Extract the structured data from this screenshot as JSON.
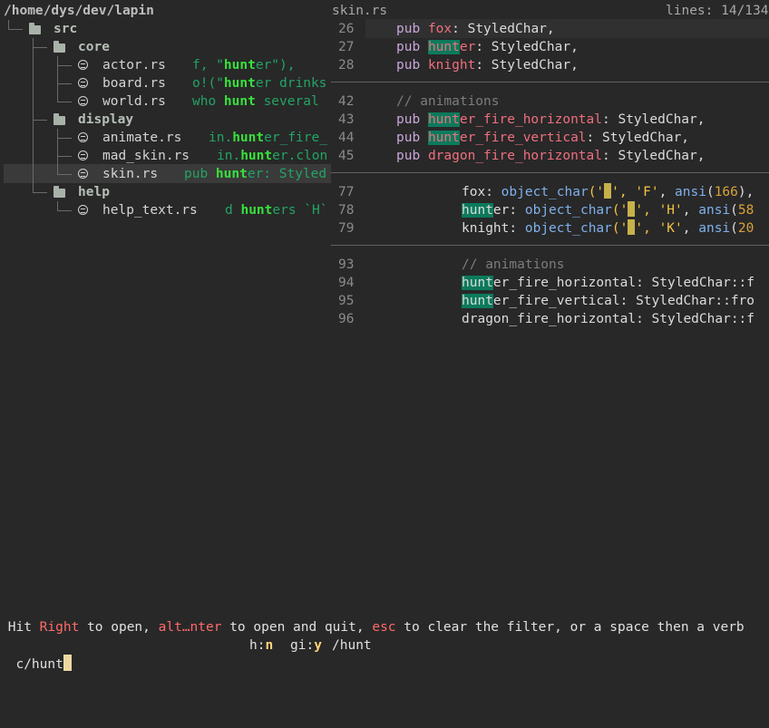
{
  "tree": {
    "root": "/home/dys/dev/lapin",
    "dirs": {
      "src": "src",
      "core": "core",
      "display": "display",
      "help": "help"
    },
    "files": [
      {
        "name": "actor.rs",
        "pre": "f, \"",
        "match": "hunt",
        "post": "er\"),"
      },
      {
        "name": "board.rs",
        "pre": "o!(\"",
        "match": "hunt",
        "post": "er drinks"
      },
      {
        "name": "world.rs",
        "pre": "who ",
        "match": "hunt",
        "post": " several"
      },
      {
        "name": "animate.rs",
        "pre": "in.",
        "match": "hunt",
        "post": "er_fire_"
      },
      {
        "name": "mad_skin.rs",
        "pre": "in.",
        "match": "hunt",
        "post": "er.clon"
      },
      {
        "name": "skin.rs",
        "pre": "pub ",
        "match": "hunt",
        "post": "er: Styled"
      },
      {
        "name": "help_text.rs",
        "pre": "d ",
        "match": "hunt",
        "post": "ers `H`"
      }
    ]
  },
  "preview": {
    "filename": "skin.rs",
    "lines_info": "lines: 14/134"
  },
  "code": {
    "l26": {
      "num": "26",
      "kw": "pub",
      "id": "fox",
      "rest": ": StyledChar,"
    },
    "l27": {
      "num": "27",
      "kw": "pub",
      "hl": "hunt",
      "id": "er",
      "rest": ": StyledChar,"
    },
    "l28": {
      "num": "28",
      "kw": "pub",
      "id": "knight",
      "rest": ": StyledChar,"
    },
    "l42": {
      "num": "42",
      "comment": "// animations"
    },
    "l43": {
      "num": "43",
      "kw": "pub",
      "hl": "hunt",
      "id": "er_fire_horizontal",
      "rest": ": StyledChar,"
    },
    "l44": {
      "num": "44",
      "kw": "pub",
      "hl": "hunt",
      "id": "er_fire_vertical",
      "rest": ": StyledChar,"
    },
    "l45": {
      "num": "45",
      "kw": "pub",
      "id": "dragon_fire_horizontal",
      "rest": ": StyledChar,"
    },
    "l77": {
      "num": "77",
      "field": "fox",
      "colon": ": ",
      "fn": "object_char",
      "open": "('",
      "close": "', ",
      "ch": "'F'",
      "comma": ", ",
      "ansi": "ansi",
      "arg": "(",
      "n": "166",
      "end": "),"
    },
    "l78": {
      "num": "78",
      "hl": "hunt",
      "field": "er",
      "colon": ": ",
      "fn": "object_char",
      "open": "('",
      "close": "', ",
      "ch": "'H'",
      "comma": ", ",
      "ansi": "ansi",
      "arg": "(",
      "n": "58",
      "end": ""
    },
    "l79": {
      "num": "79",
      "field": "knight",
      "colon": ": ",
      "fn": "object_char",
      "open": "('",
      "close": "', ",
      "ch": "'K'",
      "comma": ", ",
      "ansi": "ansi",
      "arg": "(",
      "n": "20",
      "end": ""
    },
    "l93": {
      "num": "93",
      "comment": "// animations"
    },
    "l94": {
      "num": "94",
      "hl": "hunt",
      "field": "er_fire_horizontal",
      "rest": ": StyledChar::f"
    },
    "l95": {
      "num": "95",
      "hl": "hunt",
      "field": "er_fire_vertical",
      "rest": ": StyledChar::fro"
    },
    "l96": {
      "num": "96",
      "field": "dragon_fire_horizontal",
      "rest": ": StyledChar::f"
    }
  },
  "status": {
    "p1": " Hit ",
    "k1": "Right",
    "p2": " to open, ",
    "k2": "alt…nter",
    "p3": " to open and quit, ",
    "k3": "esc",
    "p4": " to clear the filter, or a space then a verb"
  },
  "input": {
    "value": "c/hunt",
    "hint_h": "h:",
    "hint_h_key": "n",
    "hint_gi": "gi:",
    "hint_gi_key": "y",
    "hint_pattern": "/hunt"
  },
  "colors": {
    "background": "#282828",
    "match_highlight": "#0c7a5c",
    "tree_match": "#38e03c",
    "keyword": "#c8a6da",
    "identifier": "#ef6f7f"
  }
}
